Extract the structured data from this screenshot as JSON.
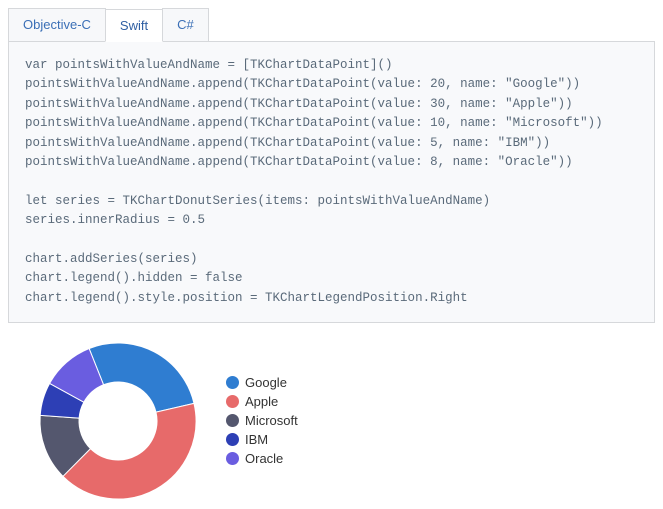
{
  "tabs": {
    "items": [
      {
        "label": "Objective-C",
        "active": false
      },
      {
        "label": "Swift",
        "active": true
      },
      {
        "label": "C#",
        "active": false
      }
    ]
  },
  "code": "var pointsWithValueAndName = [TKChartDataPoint]()\npointsWithValueAndName.append(TKChartDataPoint(value: 20, name: \"Google\"))\npointsWithValueAndName.append(TKChartDataPoint(value: 30, name: \"Apple\"))\npointsWithValueAndName.append(TKChartDataPoint(value: 10, name: \"Microsoft\"))\npointsWithValueAndName.append(TKChartDataPoint(value: 5, name: \"IBM\"))\npointsWithValueAndName.append(TKChartDataPoint(value: 8, name: \"Oracle\"))\n\nlet series = TKChartDonutSeries(items: pointsWithValueAndName)\nseries.innerRadius = 0.5\n\nchart.addSeries(series)\nchart.legend().hidden = false\nchart.legend().style.position = TKChartLegendPosition.Right",
  "chart_data": {
    "type": "pie",
    "title": "",
    "innerRadius": 0.5,
    "legendPosition": "right",
    "series": [
      {
        "name": "Google",
        "value": 20,
        "color": "#2f7dd1"
      },
      {
        "name": "Apple",
        "value": 30,
        "color": "#e76a6a"
      },
      {
        "name": "Microsoft",
        "value": 10,
        "color": "#54576e"
      },
      {
        "name": "IBM",
        "value": 5,
        "color": "#2d3fb5"
      },
      {
        "name": "Oracle",
        "value": 8,
        "color": "#6a5de0"
      }
    ]
  }
}
